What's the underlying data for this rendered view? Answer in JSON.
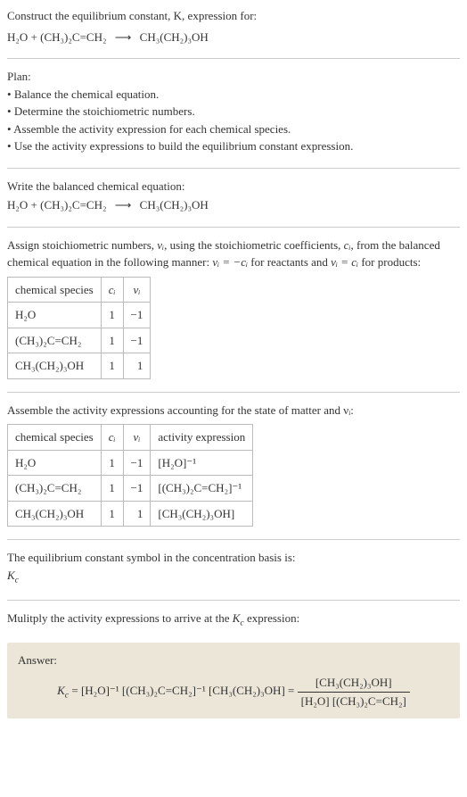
{
  "intro": {
    "construct": "Construct the equilibrium constant, K, expression for:",
    "eq_lhs1": "H₂O + (CH₃)₂C=CH₂",
    "eq_arrow": "⟶",
    "eq_rhs1": "CH₃(CH₂)₃OH"
  },
  "plan": {
    "title": "Plan:",
    "items": [
      "Balance the chemical equation.",
      "Determine the stoichiometric numbers.",
      "Assemble the activity expression for each chemical species.",
      "Use the activity expressions to build the equilibrium constant expression."
    ]
  },
  "balanced": {
    "title": "Write the balanced chemical equation:",
    "eq_lhs": "H₂O + (CH₃)₂C=CH₂",
    "eq_arrow": "⟶",
    "eq_rhs": "CH₃(CH₂)₃OH"
  },
  "stoich": {
    "desc1a": "Assign stoichiometric numbers, ",
    "desc1b": ", using the stoichiometric coefficients, ",
    "desc1c": ", from the balanced chemical equation in the following manner: ",
    "desc1d": " for reactants and ",
    "desc1e": " for products:",
    "nu_i": "νᵢ",
    "c_i": "cᵢ",
    "rel1": "νᵢ = −cᵢ",
    "rel2": "νᵢ = cᵢ",
    "head_species": "chemical species",
    "head_ci": "cᵢ",
    "head_nui": "νᵢ",
    "rows": [
      {
        "species": "H₂O",
        "ci": "1",
        "nui": "−1"
      },
      {
        "species": "(CH₃)₂C=CH₂",
        "ci": "1",
        "nui": "−1"
      },
      {
        "species": "CH₃(CH₂)₃OH",
        "ci": "1",
        "nui": "1"
      }
    ]
  },
  "activity": {
    "title": "Assemble the activity expressions accounting for the state of matter and νᵢ:",
    "head_species": "chemical species",
    "head_ci": "cᵢ",
    "head_nui": "νᵢ",
    "head_act": "activity expression",
    "rows": [
      {
        "species": "H₂O",
        "ci": "1",
        "nui": "−1",
        "act": "[H₂O]⁻¹"
      },
      {
        "species": "(CH₃)₂C=CH₂",
        "ci": "1",
        "nui": "−1",
        "act": "[(CH₃)₂C=CH₂]⁻¹"
      },
      {
        "species": "CH₃(CH₂)₃OH",
        "ci": "1",
        "nui": "1",
        "act": "[CH₃(CH₂)₃OH]"
      }
    ]
  },
  "symbol": {
    "text": "The equilibrium constant symbol in the concentration basis is:",
    "kc": "K_c"
  },
  "multiply": {
    "text1": "Mulitply the activity expressions to arrive at the ",
    "kc_inline": "K_c",
    "text2": " expression:"
  },
  "answer": {
    "label": "Answer:",
    "kc": "K_c",
    "eq_mid": " = [H₂O]⁻¹ [(CH₃)₂C=CH₂]⁻¹ [CH₃(CH₂)₃OH] = ",
    "frac_num": "[CH₃(CH₂)₃OH]",
    "frac_den": "[H₂O] [(CH₃)₂C=CH₂]"
  },
  "chart_data": {
    "type": "table",
    "title": "Stoichiometric numbers",
    "columns": [
      "chemical species",
      "cᵢ",
      "νᵢ"
    ],
    "rows": [
      [
        "H₂O",
        1,
        -1
      ],
      [
        "(CH₃)₂C=CH₂",
        1,
        -1
      ],
      [
        "CH₃(CH₂)₃OH",
        1,
        1
      ]
    ]
  }
}
